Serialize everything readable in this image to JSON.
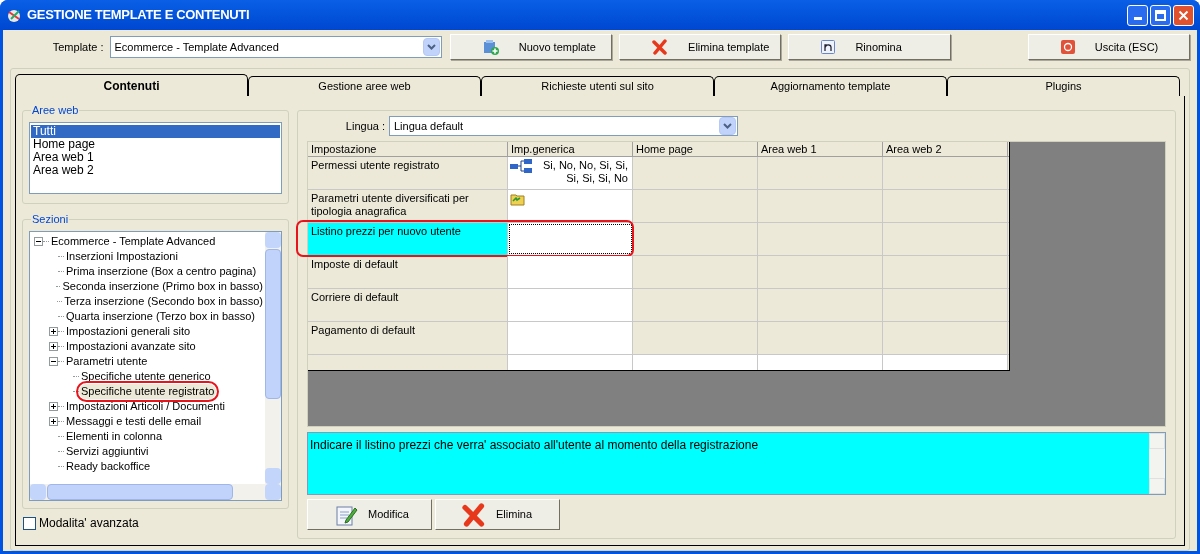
{
  "window": {
    "title": "GESTIONE TEMPLATE E CONTENUTI"
  },
  "template_field": {
    "label": "Template :",
    "value": "Ecommerce - Template Advanced"
  },
  "toolbar": [
    {
      "label": "Nuovo template",
      "kind": "new"
    },
    {
      "label": "Elimina template",
      "kind": "delete"
    },
    {
      "label": "Rinomina",
      "kind": "rename"
    },
    {
      "label": "Uscita (ESC)",
      "kind": "exit"
    }
  ],
  "tabs": [
    {
      "label": "Contenuti",
      "selected": true
    },
    {
      "label": "Gestione aree web",
      "selected": false
    },
    {
      "label": "Richieste utenti sul sito",
      "selected": false
    },
    {
      "label": "Aggiornamento template",
      "selected": false
    },
    {
      "label": "Plugins",
      "selected": false
    }
  ],
  "aree_web": {
    "title": "Aree web",
    "items": [
      {
        "label": "Tutti",
        "selected": true
      },
      {
        "label": "Home page",
        "selected": false
      },
      {
        "label": "Area web 1",
        "selected": false
      },
      {
        "label": "Area web 2",
        "selected": false
      }
    ]
  },
  "sezioni": {
    "title": "Sezioni",
    "tree": [
      {
        "label": "Ecommerce - Template Advanced",
        "expanded": true,
        "selected": false,
        "annotated": false,
        "children": [
          {
            "label": "Inserzioni Impostazioni",
            "selected": false,
            "annotated": false
          },
          {
            "label": "Prima inserzione (Box a centro pagina)",
            "selected": false,
            "annotated": false
          },
          {
            "label": "Seconda inserzione (Primo box in basso)",
            "selected": false,
            "annotated": false
          },
          {
            "label": "Terza inserzione (Secondo box in basso)",
            "selected": false,
            "annotated": false
          },
          {
            "label": "Quarta inserzione (Terzo box in basso)",
            "selected": false,
            "annotated": false
          },
          {
            "label": "Impostazioni generali sito",
            "expanded": false,
            "selected": false,
            "annotated": false
          },
          {
            "label": "Impostazioni avanzate sito",
            "expanded": false,
            "selected": false,
            "annotated": false
          },
          {
            "label": "Parametri utente",
            "expanded": true,
            "selected": false,
            "annotated": false,
            "children": [
              {
                "label": "Specifiche utente generico",
                "selected": false,
                "annotated": false
              },
              {
                "label": "Specifiche utente registrato",
                "selected": true,
                "annotated": true
              }
            ]
          },
          {
            "label": "Impostazioni Articoli / Documenti",
            "expanded": false,
            "selected": false,
            "annotated": false
          },
          {
            "label": "Messaggi e testi delle email",
            "expanded": false,
            "selected": false,
            "annotated": false
          },
          {
            "label": "Elementi in colonna",
            "selected": false,
            "annotated": false
          },
          {
            "label": "Servizi aggiuntivi",
            "selected": false,
            "annotated": false
          },
          {
            "label": "Ready backoffice",
            "selected": false,
            "annotated": false
          }
        ]
      }
    ]
  },
  "advanced_mode": {
    "label": "Modalita' avanzata",
    "checked": false
  },
  "lingua": {
    "label": "Lingua :",
    "value": "Lingua default"
  },
  "grid": {
    "columns": [
      "Impostazione",
      "Imp.generica",
      "Home page",
      "Area web 1",
      "Area web 2"
    ],
    "rows": [
      {
        "label": "Permessi utente registrato",
        "kind": "hierarchy",
        "value": "Si, No, No, Si, Si, Si, Si, Si, No",
        "selected": false,
        "annotated": false
      },
      {
        "label": "Parametri utente diversificati per tipologia anagrafica",
        "kind": "folder",
        "selected": false,
        "annotated": false
      },
      {
        "label": "Listino prezzi per nuovo utente",
        "selected": true,
        "annotated": true
      },
      {
        "label": "Imposte di default",
        "selected": false,
        "annotated": false
      },
      {
        "label": "Corriere di default",
        "selected": false,
        "annotated": false
      },
      {
        "label": "Pagamento di default",
        "selected": false,
        "annotated": false
      }
    ]
  },
  "description": "Indicare il listino prezzi che verra' associato all'utente al momento della registrazione",
  "actions": [
    {
      "label": "Modifica",
      "kind": "edit"
    },
    {
      "label": "Elimina",
      "kind": "delete"
    }
  ]
}
